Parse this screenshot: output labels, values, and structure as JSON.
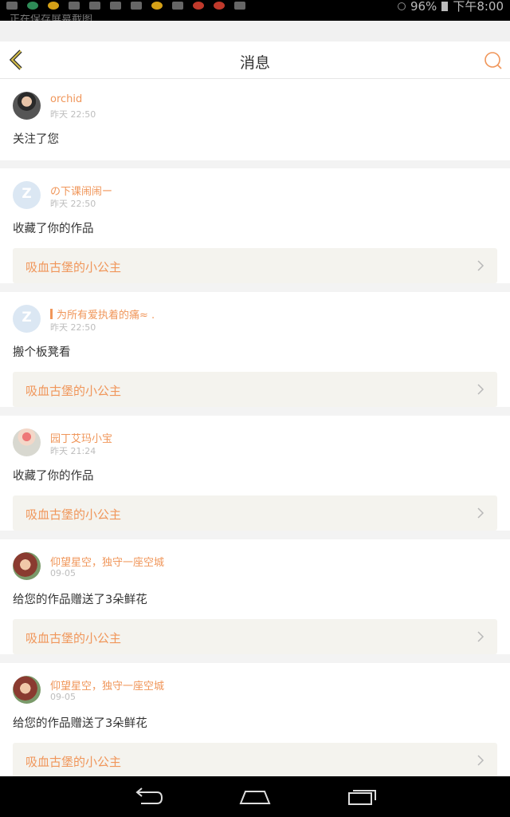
{
  "status_bar": {
    "notification_text": "正在保存屏幕截图",
    "battery": "96%",
    "time": "下午8:00"
  },
  "header": {
    "title": "消息",
    "back_icon": "chevron-left-icon",
    "search_icon": "search-icon"
  },
  "messages": [
    {
      "user": "orchid",
      "time": "昨天 22:50",
      "text": "关注了您",
      "avatar": "photo",
      "work": ""
    },
    {
      "user": "の下课闹闹ー",
      "time": "昨天 22:50",
      "text": "收藏了你的作品",
      "avatar": "default",
      "work": "吸血古堡的小公主"
    },
    {
      "user": "为所有爱执着的痛≈ .",
      "time": "昨天 22:50",
      "text": "搬个板凳看",
      "avatar": "default",
      "work": "吸血古堡的小公主"
    },
    {
      "user": "园丁艾玛小宝",
      "time": "昨天 21:24",
      "text": "收藏了你的作品",
      "avatar": "photo",
      "work": "吸血古堡的小公主"
    },
    {
      "user": "仰望星空，独守一座空城",
      "time": "09-05",
      "text": "给您的作品赠送了3朵鲜花",
      "avatar": "photo",
      "work": "吸血古堡的小公主"
    },
    {
      "user": "仰望星空，独守一座空城",
      "time": "09-05",
      "text": "给您的作品赠送了3朵鲜花",
      "avatar": "photo",
      "work": "吸血古堡的小公主"
    }
  ],
  "colors": {
    "accent": "#f0965a",
    "link_bg": "#f4f3ee",
    "page_bg": "#f3f3f3"
  },
  "nav_bar": {
    "icons": [
      "back-icon",
      "home-icon",
      "recent-apps-icon"
    ]
  }
}
